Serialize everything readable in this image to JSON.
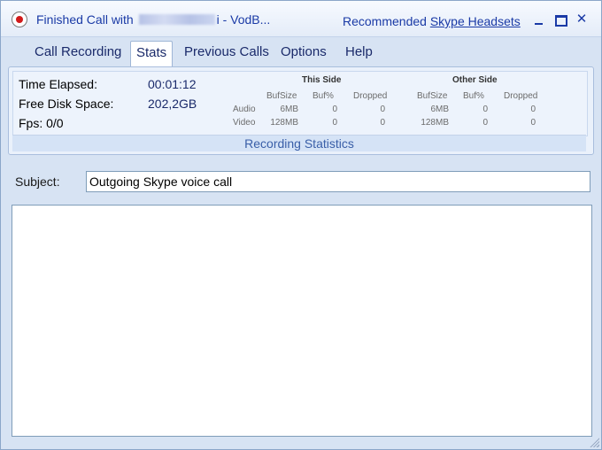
{
  "window": {
    "title_prefix": "Finished Call with",
    "title_suffix": "i - VodB...",
    "recommended_label": "Recommended",
    "recommended_link": "Skype Headsets",
    "min_label": "",
    "max_label": "",
    "close_label": "✕"
  },
  "tabs": [
    {
      "label": "Call Recording",
      "active": false
    },
    {
      "label": "Stats",
      "active": true
    },
    {
      "label": "Previous Calls",
      "active": false
    },
    {
      "label": "Options",
      "active": false
    },
    {
      "label": "Help",
      "active": false
    }
  ],
  "stats": {
    "time_elapsed_label": "Time Elapsed:",
    "time_elapsed_value": "00:01:12",
    "disk_space_label": "Free Disk Space:",
    "disk_space_value": "202,2GB",
    "fps_label": "Fps: 0/0",
    "this_side_header": "This Side",
    "other_side_header": "Other Side",
    "columns": [
      "BufSize",
      "Buf%",
      "Dropped"
    ],
    "rows": [
      {
        "label": "Audio",
        "this": [
          "6MB",
          "0",
          "0"
        ],
        "other": [
          "6MB",
          "0",
          "0"
        ]
      },
      {
        "label": "Video",
        "this": [
          "128MB",
          "0",
          "0"
        ],
        "other": [
          "128MB",
          "0",
          "0"
        ]
      }
    ],
    "footer": "Recording Statistics"
  },
  "subject": {
    "label": "Subject:",
    "value": "Outgoing Skype voice call"
  },
  "notes": {
    "value": ""
  }
}
